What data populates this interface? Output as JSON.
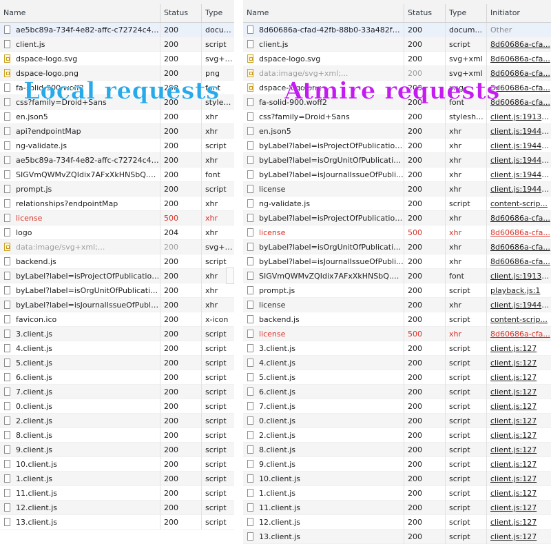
{
  "colors": {
    "error": "#d93025",
    "overlay_local": "#27a9ea",
    "overlay_atmire": "#c31cf0",
    "selected_row": "#eaf1fb"
  },
  "overlays": {
    "local": "Local requests",
    "atmire": "Atmire requests"
  },
  "local": {
    "columns": {
      "name": "Name",
      "status": "Status",
      "type": "Type"
    },
    "rows": [
      {
        "name": "ae5bc89a-734f-4e82-affc-c72724c42...",
        "status": "200",
        "type": "docum...",
        "icon": "file-icon",
        "selected": true
      },
      {
        "name": "client.js",
        "status": "200",
        "type": "script",
        "icon": "file-icon"
      },
      {
        "name": "dspace-logo.svg",
        "status": "200",
        "type": "svg+xml",
        "icon": "image-icon"
      },
      {
        "name": "dspace-logo.png",
        "status": "200",
        "type": "png",
        "icon": "image-icon"
      },
      {
        "name": "fa-solid-900.woff2",
        "status": "200",
        "type": "font",
        "icon": "file-icon"
      },
      {
        "name": "css?family=Droid+Sans",
        "status": "200",
        "type": "stylesh...",
        "icon": "file-icon"
      },
      {
        "name": "en.json5",
        "status": "200",
        "type": "xhr",
        "icon": "file-icon"
      },
      {
        "name": "api?endpointMap",
        "status": "200",
        "type": "xhr",
        "icon": "file-icon"
      },
      {
        "name": "ng-validate.js",
        "status": "200",
        "type": "script",
        "icon": "file-icon"
      },
      {
        "name": "ae5bc89a-734f-4e82-affc-c72724c42...",
        "status": "200",
        "type": "xhr",
        "icon": "file-icon"
      },
      {
        "name": "SIGVmQWMvZQIdix7AFxXkHNSbQ.w...",
        "status": "200",
        "type": "font",
        "icon": "file-icon"
      },
      {
        "name": "prompt.js",
        "status": "200",
        "type": "script",
        "icon": "file-icon"
      },
      {
        "name": "relationships?endpointMap",
        "status": "200",
        "type": "xhr",
        "icon": "file-icon"
      },
      {
        "name": "license",
        "status": "500",
        "type": "xhr",
        "icon": "file-icon",
        "error": true
      },
      {
        "name": "logo",
        "status": "204",
        "type": "xhr",
        "icon": "file-icon"
      },
      {
        "name": "data:image/svg+xml;...",
        "status": "200",
        "type": "svg+xml",
        "icon": "image-icon",
        "dim": true
      },
      {
        "name": "backend.js",
        "status": "200",
        "type": "script",
        "icon": "file-icon"
      },
      {
        "name": "byLabel?label=isProjectOfPublication...",
        "status": "200",
        "type": "xhr",
        "icon": "file-icon"
      },
      {
        "name": "byLabel?label=isOrgUnitOfPublicatio...",
        "status": "200",
        "type": "xhr",
        "icon": "file-icon"
      },
      {
        "name": "byLabel?label=isJournalIssueOfPubli...",
        "status": "200",
        "type": "xhr",
        "icon": "file-icon"
      },
      {
        "name": "favicon.ico",
        "status": "200",
        "type": "x-icon",
        "icon": "file-icon"
      },
      {
        "name": "3.client.js",
        "status": "200",
        "type": "script",
        "icon": "file-icon"
      },
      {
        "name": "4.client.js",
        "status": "200",
        "type": "script",
        "icon": "file-icon"
      },
      {
        "name": "5.client.js",
        "status": "200",
        "type": "script",
        "icon": "file-icon"
      },
      {
        "name": "6.client.js",
        "status": "200",
        "type": "script",
        "icon": "file-icon"
      },
      {
        "name": "7.client.js",
        "status": "200",
        "type": "script",
        "icon": "file-icon"
      },
      {
        "name": "0.client.js",
        "status": "200",
        "type": "script",
        "icon": "file-icon"
      },
      {
        "name": "2.client.js",
        "status": "200",
        "type": "script",
        "icon": "file-icon"
      },
      {
        "name": "8.client.js",
        "status": "200",
        "type": "script",
        "icon": "file-icon"
      },
      {
        "name": "9.client.js",
        "status": "200",
        "type": "script",
        "icon": "file-icon"
      },
      {
        "name": "10.client.js",
        "status": "200",
        "type": "script",
        "icon": "file-icon"
      },
      {
        "name": "1.client.js",
        "status": "200",
        "type": "script",
        "icon": "file-icon"
      },
      {
        "name": "11.client.js",
        "status": "200",
        "type": "script",
        "icon": "file-icon"
      },
      {
        "name": "12.client.js",
        "status": "200",
        "type": "script",
        "icon": "file-icon"
      },
      {
        "name": "13.client.js",
        "status": "200",
        "type": "script",
        "icon": "file-icon"
      }
    ]
  },
  "atmire": {
    "columns": {
      "name": "Name",
      "status": "Status",
      "type": "Type",
      "initiator": "Initiator"
    },
    "rows": [
      {
        "name": "8d60686a-cfad-42fb-88b0-33a482fa...",
        "status": "200",
        "type": "docum...",
        "initiator": "Other",
        "initiator_style": "other",
        "icon": "file-icon",
        "selected": true
      },
      {
        "name": "client.js",
        "status": "200",
        "type": "script",
        "initiator": "8d60686a-cfa...",
        "icon": "file-icon"
      },
      {
        "name": "dspace-logo.svg",
        "status": "200",
        "type": "svg+xml",
        "initiator": "8d60686a-cfa...",
        "icon": "image-icon"
      },
      {
        "name": "data:image/svg+xml;...",
        "status": "200",
        "type": "svg+xml",
        "initiator": "8d60686a-cfa...",
        "icon": "image-icon",
        "dim": true
      },
      {
        "name": "dspace-logo.png",
        "status": "200",
        "type": "png",
        "initiator": "8d60686a-cfa...",
        "icon": "image-icon"
      },
      {
        "name": "fa-solid-900.woff2",
        "status": "200",
        "type": "font",
        "initiator": "8d60686a-cfa...",
        "icon": "file-icon"
      },
      {
        "name": "css?family=Droid+Sans",
        "status": "200",
        "type": "stylesh...",
        "initiator": "client.js:191392",
        "icon": "file-icon"
      },
      {
        "name": "en.json5",
        "status": "200",
        "type": "xhr",
        "initiator": "client.js:194480",
        "icon": "file-icon"
      },
      {
        "name": "byLabel?label=isProjectOfPublication...",
        "status": "200",
        "type": "xhr",
        "initiator": "client.js:194480",
        "icon": "file-icon"
      },
      {
        "name": "byLabel?label=isOrgUnitOfPublicatio...",
        "status": "200",
        "type": "xhr",
        "initiator": "client.js:194480",
        "icon": "file-icon"
      },
      {
        "name": "byLabel?label=isJournalIssueOfPubli...",
        "status": "200",
        "type": "xhr",
        "initiator": "client.js:194480",
        "icon": "file-icon"
      },
      {
        "name": "license",
        "status": "200",
        "type": "xhr",
        "initiator": "client.js:194480",
        "icon": "file-icon"
      },
      {
        "name": "ng-validate.js",
        "status": "200",
        "type": "script",
        "initiator": "content-scrip...",
        "icon": "file-icon"
      },
      {
        "name": "byLabel?label=isProjectOfPublication...",
        "status": "200",
        "type": "xhr",
        "initiator": "8d60686a-cfa...",
        "icon": "file-icon"
      },
      {
        "name": "license",
        "status": "500",
        "type": "xhr",
        "initiator": "8d60686a-cfa...",
        "icon": "file-icon",
        "error": true
      },
      {
        "name": "byLabel?label=isOrgUnitOfPublicatio...",
        "status": "200",
        "type": "xhr",
        "initiator": "8d60686a-cfa...",
        "icon": "file-icon"
      },
      {
        "name": "byLabel?label=isJournalIssueOfPubli...",
        "status": "200",
        "type": "xhr",
        "initiator": "8d60686a-cfa...",
        "icon": "file-icon"
      },
      {
        "name": "SIGVmQWMvZQIdix7AFxXkHNSbQ.w...",
        "status": "200",
        "type": "font",
        "initiator": "client.js:191396",
        "icon": "file-icon"
      },
      {
        "name": "prompt.js",
        "status": "200",
        "type": "script",
        "initiator": "playback.js:1",
        "icon": "file-icon"
      },
      {
        "name": "license",
        "status": "200",
        "type": "xhr",
        "initiator": "client.js:194480",
        "icon": "file-icon"
      },
      {
        "name": "backend.js",
        "status": "200",
        "type": "script",
        "initiator": "content-scrip...",
        "icon": "file-icon"
      },
      {
        "name": "license",
        "status": "500",
        "type": "xhr",
        "initiator": "8d60686a-cfa...",
        "icon": "file-icon",
        "error": true
      },
      {
        "name": "3.client.js",
        "status": "200",
        "type": "script",
        "initiator": "client.js:127",
        "icon": "file-icon"
      },
      {
        "name": "4.client.js",
        "status": "200",
        "type": "script",
        "initiator": "client.js:127",
        "icon": "file-icon"
      },
      {
        "name": "5.client.js",
        "status": "200",
        "type": "script",
        "initiator": "client.js:127",
        "icon": "file-icon"
      },
      {
        "name": "6.client.js",
        "status": "200",
        "type": "script",
        "initiator": "client.js:127",
        "icon": "file-icon"
      },
      {
        "name": "7.client.js",
        "status": "200",
        "type": "script",
        "initiator": "client.js:127",
        "icon": "file-icon"
      },
      {
        "name": "0.client.js",
        "status": "200",
        "type": "script",
        "initiator": "client.js:127",
        "icon": "file-icon"
      },
      {
        "name": "2.client.js",
        "status": "200",
        "type": "script",
        "initiator": "client.js:127",
        "icon": "file-icon"
      },
      {
        "name": "8.client.js",
        "status": "200",
        "type": "script",
        "initiator": "client.js:127",
        "icon": "file-icon"
      },
      {
        "name": "9.client.js",
        "status": "200",
        "type": "script",
        "initiator": "client.js:127",
        "icon": "file-icon"
      },
      {
        "name": "10.client.js",
        "status": "200",
        "type": "script",
        "initiator": "client.js:127",
        "icon": "file-icon"
      },
      {
        "name": "1.client.js",
        "status": "200",
        "type": "script",
        "initiator": "client.js:127",
        "icon": "file-icon"
      },
      {
        "name": "11.client.js",
        "status": "200",
        "type": "script",
        "initiator": "client.js:127",
        "icon": "file-icon"
      },
      {
        "name": "12.client.js",
        "status": "200",
        "type": "script",
        "initiator": "client.js:127",
        "icon": "file-icon"
      },
      {
        "name": "13.client.js",
        "status": "200",
        "type": "script",
        "initiator": "client.js:127",
        "icon": "file-icon"
      }
    ]
  }
}
